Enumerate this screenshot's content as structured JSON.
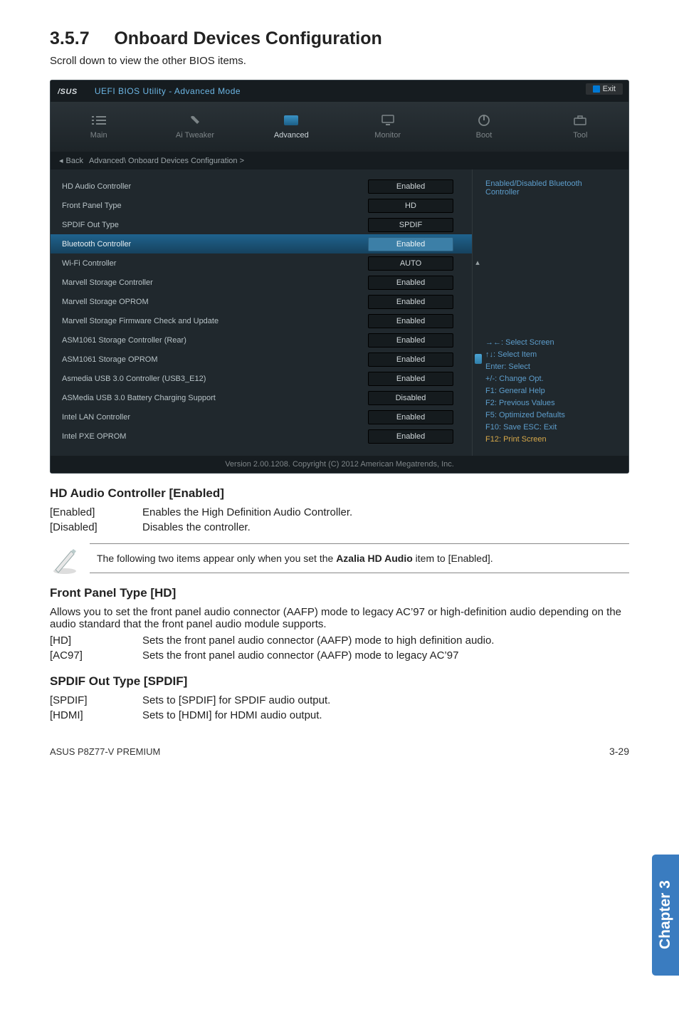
{
  "section": {
    "num": "3.5.7",
    "title": "Onboard Devices Configuration",
    "subtitle": "Scroll down to view the other BIOS items."
  },
  "bios": {
    "logo_text": "UEFI BIOS Utility - Advanced Mode",
    "exit_label": "Exit",
    "tabs": {
      "main": "Main",
      "ai": "Ai Tweaker",
      "adv": "Advanced",
      "mon": "Monitor",
      "boot": "Boot",
      "tool": "Tool"
    },
    "breadcrumb": {
      "back": "Back",
      "path": "Advanced\\ Onboard Devices Configuration  >"
    },
    "rows": [
      {
        "cap": "HD Audio Controller",
        "val": "Enabled"
      },
      {
        "cap": "Front Panel Type",
        "val": "HD"
      },
      {
        "cap": "SPDIF Out Type",
        "val": "SPDIF"
      },
      {
        "cap": "Bluetooth Controller",
        "val": "Enabled",
        "sel": true
      },
      {
        "cap": "Wi-Fi Controller",
        "val": "AUTO"
      },
      {
        "cap": "Marvell Storage Controller",
        "val": "Enabled"
      },
      {
        "cap": "Marvell Storage OPROM",
        "val": "Enabled"
      },
      {
        "cap": "Marvell Storage Firmware Check and Update",
        "val": "Enabled"
      },
      {
        "cap": "ASM1061 Storage Controller (Rear)",
        "val": "Enabled"
      },
      {
        "cap": "ASM1061 Storage OPROM",
        "val": "Enabled"
      },
      {
        "cap": "Asmedia USB 3.0 Controller (USB3_E12)",
        "val": "Enabled"
      },
      {
        "cap": "ASMedia USB 3.0 Battery Charging Support",
        "val": "Disabled"
      },
      {
        "cap": "Intel LAN Controller",
        "val": "Enabled"
      },
      {
        "cap": "Intel PXE OPROM",
        "val": "Enabled"
      }
    ],
    "help_title": "Enabled/Disabled Bluetooth Controller",
    "nav": {
      "l1": "→←: Select Screen",
      "l2": "↑↓: Select Item",
      "l3": "Enter: Select",
      "l4": "+/-: Change Opt.",
      "l5": "F1: General Help",
      "l6": "F2: Previous Values",
      "l7": "F5: Optimized Defaults",
      "l8": "F10: Save   ESC: Exit",
      "l9": "F12: Print Screen"
    },
    "version": "Version  2.00.1208.  Copyright  (C)  2012 American  Megatrends,  Inc."
  },
  "hdaudio": {
    "heading": "HD Audio Controller [Enabled]",
    "opt1k": "[Enabled]",
    "opt1v": "Enables the High Definition Audio Controller.",
    "opt2k": "[Disabled]",
    "opt2v": "Disables the controller."
  },
  "note_pre": "The following two items appear only when you set the ",
  "note_bold": "Azalia HD Audio",
  "note_post": " item to [Enabled].",
  "fpt": {
    "heading": "Front Panel Type [HD]",
    "desc": "Allows you to set the front panel audio connector (AAFP) mode to legacy AC’97 or high-definition audio depending on the audio standard that the front panel audio module supports.",
    "opt1k": "[HD]",
    "opt1v": "Sets the front panel audio connector (AAFP) mode to high definition audio.",
    "opt2k": "[AC97]",
    "opt2v": "Sets the front panel audio connector (AAFP) mode to legacy AC’97"
  },
  "spdif": {
    "heading": "SPDIF Out Type [SPDIF]",
    "opt1k": "[SPDIF]",
    "opt1v": "Sets to [SPDIF] for SPDIF audio output.",
    "opt2k": "[HDMI]",
    "opt2v": "Sets to [HDMI] for HDMI audio output."
  },
  "chapter_tab": "Chapter 3",
  "footer_left": "ASUS P8Z77-V PREMIUM",
  "footer_right": "3-29"
}
